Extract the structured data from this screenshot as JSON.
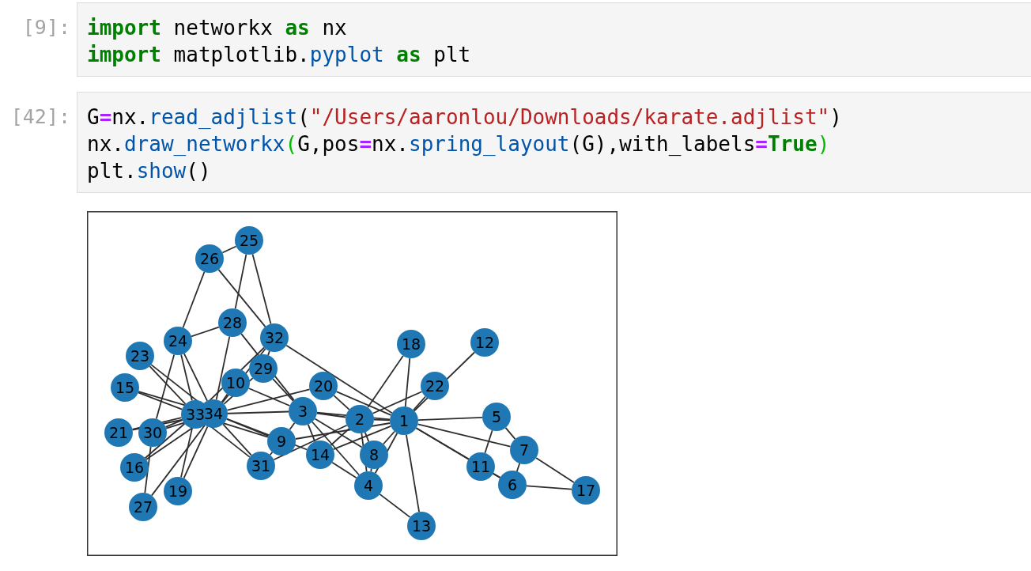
{
  "cells": [
    {
      "prompt": "[9]:",
      "lines": [
        {
          "tokens": [
            {
              "text": "import",
              "kind": "keyword"
            },
            {
              "text": " networkx ",
              "kind": "plain"
            },
            {
              "text": "as",
              "kind": "keyword"
            },
            {
              "text": " nx",
              "kind": "plain"
            }
          ]
        },
        {
          "tokens": [
            {
              "text": "import",
              "kind": "keyword"
            },
            {
              "text": " matplotlib.",
              "kind": "plain"
            },
            {
              "text": "pyplot",
              "kind": "call"
            },
            {
              "text": " as",
              "kind": "keyword"
            },
            {
              "text": " plt",
              "kind": "plain"
            }
          ]
        }
      ]
    },
    {
      "prompt": "[42]:",
      "lines": [
        {
          "tokens": [
            {
              "text": "G",
              "kind": "plain"
            },
            {
              "text": "=",
              "kind": "operator"
            },
            {
              "text": "nx.",
              "kind": "plain"
            },
            {
              "text": "read_adjlist",
              "kind": "call"
            },
            {
              "text": "(",
              "kind": "plain"
            },
            {
              "text": "\"/Users/aaronlou/Downloads/karate.adjlist\"",
              "kind": "string"
            },
            {
              "text": ")",
              "kind": "plain"
            }
          ]
        },
        {
          "tokens": [
            {
              "text": "nx.",
              "kind": "plain"
            },
            {
              "text": "draw_networkx",
              "kind": "call"
            },
            {
              "text": "(",
              "kind": "matched-bracket"
            },
            {
              "text": "G,pos",
              "kind": "plain"
            },
            {
              "text": "=",
              "kind": "operator"
            },
            {
              "text": "nx.",
              "kind": "plain"
            },
            {
              "text": "spring_layout",
              "kind": "call"
            },
            {
              "text": "(G),with_labels",
              "kind": "plain"
            },
            {
              "text": "=",
              "kind": "operator"
            },
            {
              "text": "True",
              "kind": "keyword"
            },
            {
              "text": ")",
              "kind": "matched-bracket"
            }
          ]
        },
        {
          "tokens": [
            {
              "text": "plt.",
              "kind": "plain"
            },
            {
              "text": "show",
              "kind": "call"
            },
            {
              "text": "()",
              "kind": "plain"
            }
          ]
        }
      ],
      "output": {
        "graph": {
          "nodes": [
            {
              "label": "25"
            },
            {
              "label": "26"
            },
            {
              "label": "28"
            },
            {
              "label": "24"
            },
            {
              "label": "32"
            },
            {
              "label": "18"
            },
            {
              "label": "12"
            },
            {
              "label": "23"
            },
            {
              "label": "29"
            },
            {
              "label": "15"
            },
            {
              "label": "10"
            },
            {
              "label": "20"
            },
            {
              "label": "22"
            },
            {
              "label": "33"
            },
            {
              "label": "34"
            },
            {
              "label": "3"
            },
            {
              "label": "2"
            },
            {
              "label": "1"
            },
            {
              "label": "5"
            },
            {
              "label": "21"
            },
            {
              "label": "30"
            },
            {
              "label": "9"
            },
            {
              "label": "14"
            },
            {
              "label": "8"
            },
            {
              "label": "7"
            },
            {
              "label": "16"
            },
            {
              "label": "31"
            },
            {
              "label": "11"
            },
            {
              "label": "19"
            },
            {
              "label": "4"
            },
            {
              "label": "6"
            },
            {
              "label": "17"
            },
            {
              "label": "27"
            },
            {
              "label": "13"
            }
          ]
        }
      }
    }
  ]
}
